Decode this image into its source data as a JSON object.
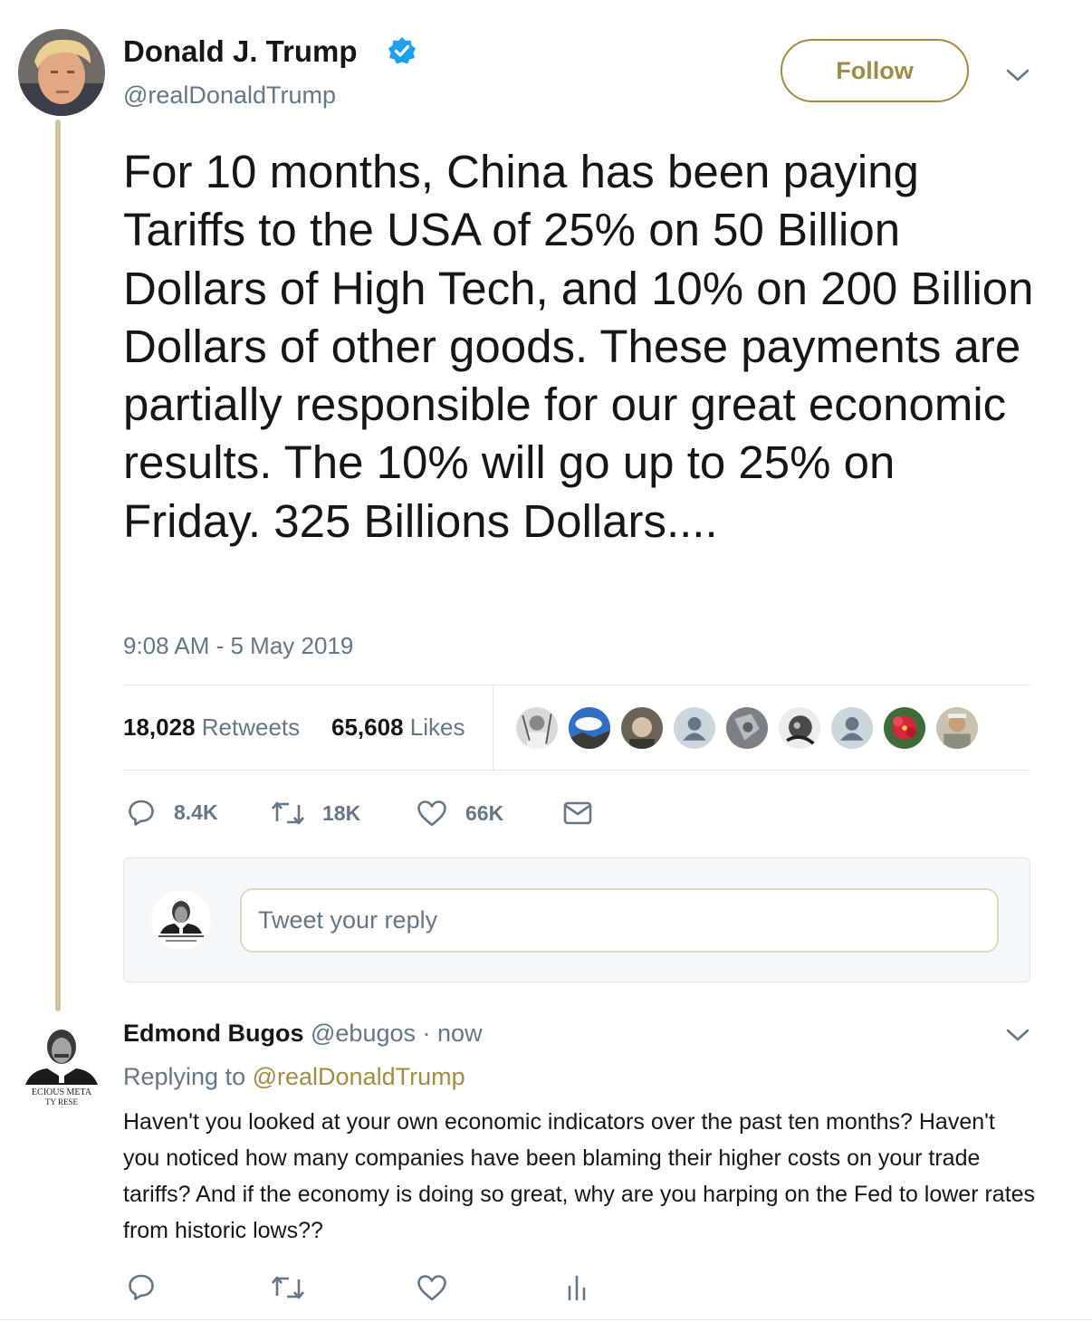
{
  "tweet": {
    "author": {
      "name": "Donald J. Trump",
      "handle": "@realDonaldTrump",
      "verified": true
    },
    "follow_label": "Follow",
    "text": "For 10 months, China has been paying Tariffs to the USA of 25% on 50 Billion Dollars of High Tech, and 10% on 200 Billion Dollars of other goods. These payments are partially responsible for our great economic results. The 10% will go up to 25% on Friday. 325 Billions Dollars....",
    "timestamp": "9:08 AM - 5 May 2019",
    "stats": {
      "retweets_count": "18,028",
      "retweets_label": "Retweets",
      "likes_count": "65,608",
      "likes_label": "Likes"
    },
    "liker_avatars": [
      "sketch-portrait",
      "sky-landscape",
      "face-photo",
      "default-avatar",
      "gray-photo",
      "bw-face",
      "default-avatar",
      "red-flower",
      "elder-portrait"
    ],
    "actions": {
      "replies": "8.4K",
      "retweets": "18K",
      "likes": "66K",
      "message_icon": "envelope-icon"
    }
  },
  "reply_composer": {
    "placeholder": "Tweet your reply"
  },
  "reply": {
    "name": "Edmond Bugos",
    "handle": "@ebugos",
    "separator": "·",
    "time": "now",
    "replying_prefix": "Replying to",
    "replying_to": "@realDonaldTrump",
    "text": "Haven't you looked at your own economic indicators over the past ten months? Haven't you noticed how many companies have been blaming their higher costs on your trade tariffs? And if the economy is doing so great, why are you harping on the Fed to lower rates from historic lows??",
    "avatar_caption_line1": "ECIOUS META",
    "avatar_caption_line2": "TY RESE"
  },
  "colors": {
    "accent": "#a08c45",
    "thread_line": "#d0c49e",
    "secondary_text": "#657786",
    "verified": "#1da1f2"
  }
}
